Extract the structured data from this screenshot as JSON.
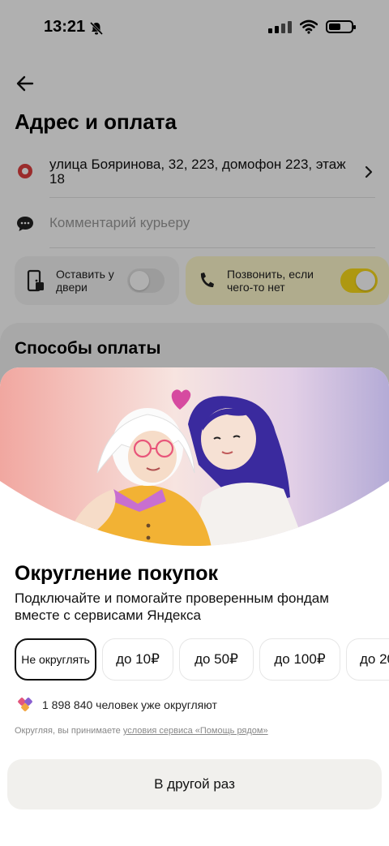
{
  "status_bar": {
    "time": "13:21"
  },
  "header": {
    "title": "Адрес и оплата"
  },
  "address": {
    "text": "улица Бояринова, 32, 223, домофон 223, этаж 18"
  },
  "comment": {
    "placeholder": "Комментарий курьеру"
  },
  "options": {
    "leave_at_door": {
      "label": "Оставить у двери",
      "enabled": false
    },
    "call_if_missing": {
      "label": "Позвонить, если чего-то нет",
      "enabled": true
    }
  },
  "payment": {
    "title": "Способы оплаты"
  },
  "sheet": {
    "title": "Округление покупок",
    "subtitle": "Подключайте и помогайте проверенным фондам вместе с сервисами Яндекса",
    "chips": [
      "Не округлять",
      "до 10₽",
      "до 50₽",
      "до 100₽",
      "до 20"
    ],
    "selected_chip": "Не округлять",
    "stats_text": "1 898 840 человек уже округляют",
    "terms_prefix": "Округляя, вы принимаете ",
    "terms_link": "условия сервиса «Помощь рядом»",
    "later_button": "В другой раз"
  },
  "colors": {
    "toggle_on": "#fcdd1a",
    "heart": "#d64aa0",
    "pin": "#e04040"
  }
}
